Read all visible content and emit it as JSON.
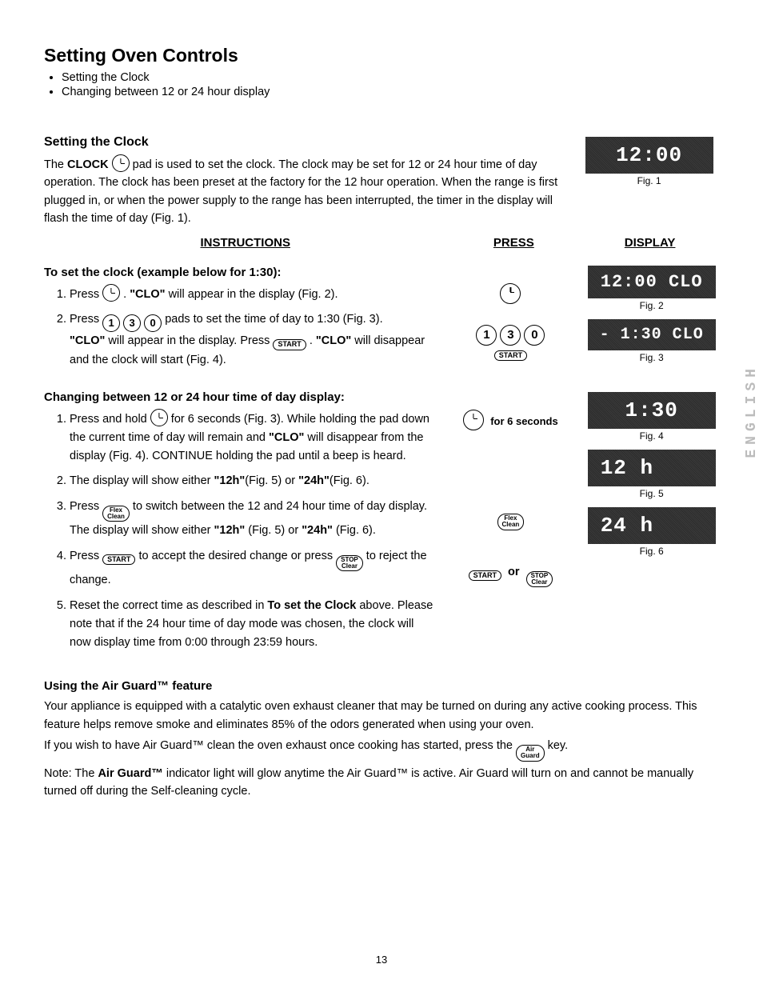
{
  "title": "Setting Oven Controls",
  "toc": [
    "Setting the Clock",
    "Changing between 12 or 24 hour display"
  ],
  "section_clock_heading": "Setting the Clock",
  "clock_intro_prefix": "The ",
  "clock_intro_bold": "CLOCK",
  "clock_intro_rest": " pad is used to set the clock. The clock may be set for 12 or 24 hour time of day operation.  The clock has been preset at the factory for the 12 hour operation.  When the range is first plugged in, or when the power supply to the range has been interrupted, the timer in the display will flash the time of day (Fig. 1).",
  "columns": {
    "instructions": "INSTRUCTIONS",
    "press": "PRESS",
    "display": "DISPLAY"
  },
  "set_clock_heading": "To set the clock (example below for 1:30):",
  "steps_set": {
    "s1_a": "Press ",
    "s1_b": " .  ",
    "s1_clo": "\"CLO\"",
    "s1_c": " will appear in the display (Fig. 2).",
    "s2_a": "Press ",
    "s2_b": " pads to set the time of day to 1:30 (Fig. 3).",
    "s2_c1": "\"CLO\"",
    "s2_c2": " will appear in the display.  Press ",
    "s2_c3": " .  ",
    "s2_c4": "\"CLO\"",
    "s2_c5": " will disappear and the clock will start (Fig. 4)."
  },
  "digits": [
    "1",
    "3",
    "0"
  ],
  "start_label": "START",
  "stop_label_top": "STOP",
  "stop_label_bot": "Clear",
  "flex_label_top": "Flex",
  "flex_label_bot": "Clean",
  "air_label_top": "Air",
  "air_label_bot": "Guard",
  "change_heading": "Changing between 12 or 24 hour time of day display:",
  "steps_change": {
    "s1_a": "Press and hold ",
    "s1_b": " for 6 seconds (Fig. 3). While holding the pad down the current time of day will remain and ",
    "s1_clo": "\"CLO\"",
    "s1_c": " will disappear from the display (Fig. 4). CONTINUE holding the pad until a beep is heard.",
    "s2_a": "The display will show either ",
    "s2_b": "\"12h\"",
    "s2_c": "(Fig. 5) or ",
    "s2_d": "\"24h\"",
    "s2_e": "(Fig. 6).",
    "s3_a": "Press ",
    "s3_b": " to switch between the 12 and 24 hour time of day display. The display will show either ",
    "s3_c": "\"12h\"",
    "s3_d": " (Fig. 5) or ",
    "s3_e": "\"24h\"",
    "s3_f": " (Fig. 6).",
    "s4_a": "Press ",
    "s4_b": " to accept the desired change or press ",
    "s4_c": " to reject the change.",
    "s5_a": "Reset the correct time as described in ",
    "s5_b": "To set the Clock",
    "s5_c": " above. Please note that if the 24 hour time of day mode was chosen, the clock will now display time from 0:00 through 23:59 hours."
  },
  "press_hold_suffix": "for 6 seconds",
  "press_or": "or",
  "displays": {
    "fig1": {
      "text": "12:00",
      "cap": "Fig. 1"
    },
    "fig2": {
      "text": "12:00 CLO",
      "cap": "Fig. 2"
    },
    "fig3": {
      "text": "-  1:30 CLO",
      "cap": "Fig. 3"
    },
    "fig4": {
      "text": "1:30",
      "cap": "Fig. 4"
    },
    "fig5": {
      "text": "12 h",
      "cap": "Fig. 5"
    },
    "fig6": {
      "text": "24 h",
      "cap": "Fig. 6"
    }
  },
  "airguard": {
    "heading": "Using the Air Guard™ feature",
    "p1": "Your appliance is equipped with a catalytic oven exhaust cleaner that may be turned on during any active cooking process. This feature helps remove smoke and eliminates 85% of the odors generated when using your oven.",
    "p2_a": "If you wish to have Air Guard™ clean the oven exhaust once cooking has started, press the ",
    "p2_b": " key.",
    "p3_a": "Note: The ",
    "p3_b": "Air Guard™",
    "p3_c": " indicator light will glow anytime the Air Guard™ is active. Air Guard will turn on and cannot be manually turned off during the Self-cleaning cycle."
  },
  "page_number": "13",
  "side_tab": "ENGLISH"
}
